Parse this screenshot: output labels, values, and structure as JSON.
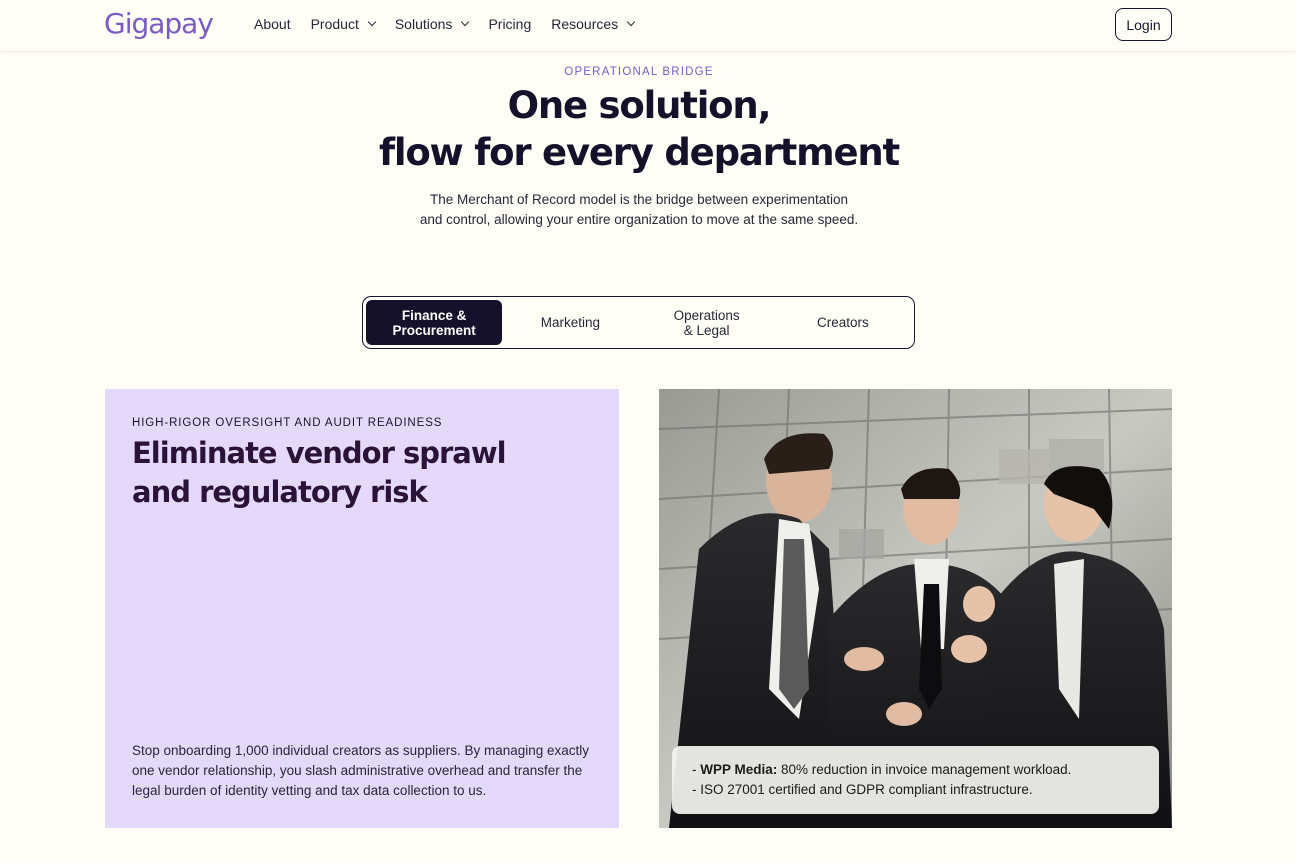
{
  "nav": {
    "logo": "Gigapay",
    "links": [
      {
        "label": "About",
        "dropdown": false
      },
      {
        "label": "Product",
        "dropdown": true
      },
      {
        "label": "Solutions",
        "dropdown": true
      },
      {
        "label": "Pricing",
        "dropdown": false
      },
      {
        "label": "Resources",
        "dropdown": true
      }
    ],
    "login_label": "Login"
  },
  "hero": {
    "eyebrow": "OPERATIONAL BRIDGE",
    "title_line1": "One solution,",
    "title_line2": "flow for every department",
    "subtitle_line1": "The Merchant of Record model is the bridge between experimentation",
    "subtitle_line2": "and control, allowing your entire organization to move at the same speed."
  },
  "tabs": [
    {
      "line1": "Finance &",
      "line2": "Procurement",
      "active": true
    },
    {
      "line1": "Marketing",
      "line2": "",
      "active": false
    },
    {
      "line1": "Operations",
      "line2": "& Legal",
      "active": false
    },
    {
      "line1": "Creators",
      "line2": "",
      "active": false
    }
  ],
  "card": {
    "eyebrow": "HIGH-RIGOR OVERSIGHT AND AUDIT READINESS",
    "title_line1": "Eliminate vendor sprawl",
    "title_line2": "and regulatory risk",
    "body": "Stop onboarding 1,000 individual creators as suppliers. By managing exactly one vendor relationship, you slash administrative overhead and transfer the legal burden of identity vetting and tax data collection to us."
  },
  "caption": {
    "line1_prefix": "- ",
    "line1_bold": "WPP Media:",
    "line1_rest": " 80% reduction in invoice management workload.",
    "line2": "- ISO 27001 certified and GDPR compliant infrastructure."
  },
  "colors": {
    "accent": "#7a5bc2",
    "dark": "#15112a",
    "card_bg": "#e4d9fa",
    "page_bg": "#fefef6"
  }
}
